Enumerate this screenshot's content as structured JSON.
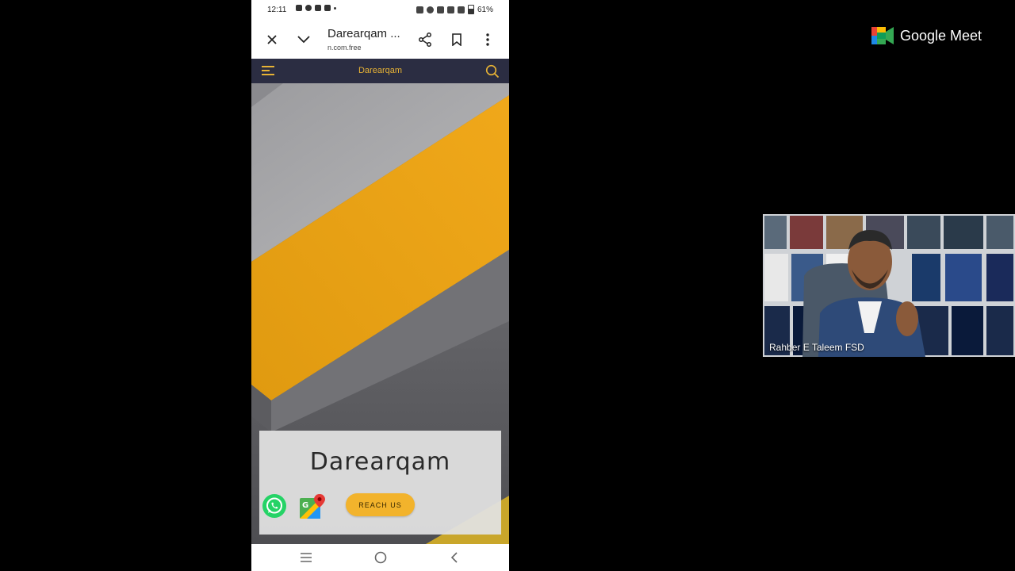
{
  "status_bar": {
    "time": "12:11",
    "battery": "61%"
  },
  "browser": {
    "title": "Darearqam ...",
    "url": "n.com.free"
  },
  "site_nav": {
    "title": "Darearqam"
  },
  "hero_card": {
    "title": "Darearqam",
    "reach_label": "REACH US"
  },
  "meet": {
    "logo_text": "Google Meet",
    "participant_name": "Rahber E Taleem FSD"
  },
  "colors": {
    "accent": "#e8b335",
    "nav_bg": "#2b2d42",
    "button": "#f2b32c"
  }
}
